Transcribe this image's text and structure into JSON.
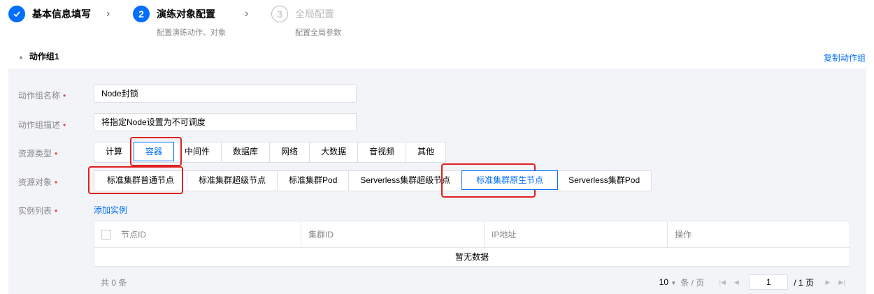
{
  "steps": [
    {
      "title": "基本信息填写",
      "status": "done"
    },
    {
      "index": "2",
      "title": "演练对象配置",
      "subtitle": "配置演练动作、对象",
      "status": "active"
    },
    {
      "index": "3",
      "title": "全局配置",
      "subtitle": "配置全局参数",
      "status": "pending"
    }
  ],
  "group": {
    "title": "动作组1",
    "copy_label": "复制动作组"
  },
  "form": {
    "name_label": "动作组名称",
    "name_value": "Node封锁",
    "desc_label": "动作组描述",
    "desc_value": "将指定Node设置为不可调度",
    "resource_type_label": "资源类型",
    "resource_types": [
      "计算",
      "容器",
      "中间件",
      "数据库",
      "网络",
      "大数据",
      "音视频",
      "其他"
    ],
    "resource_type_selected": "容器",
    "resource_object_label": "资源对象",
    "resource_objects": [
      "标准集群普通节点",
      "标准集群超级节点",
      "标准集群Pod",
      "Serverless集群超级节点",
      "标准集群原生节点",
      "Serverless集群Pod"
    ],
    "resource_object_selected": "标准集群原生节点",
    "instance_label": "实例列表",
    "add_instance": "添加实例"
  },
  "table": {
    "columns": [
      "节点ID",
      "集群ID",
      "IP地址",
      "操作"
    ],
    "empty_text": "暂无数据"
  },
  "pagination": {
    "total_text": "共 0 条",
    "page_size": "10",
    "per_page_text": "条 / 页",
    "current_page": "1",
    "total_pages_text": "/ 1 页"
  },
  "colors": {
    "accent": "#006eff",
    "highlight_box": "#e02020",
    "required": "#e54545"
  }
}
